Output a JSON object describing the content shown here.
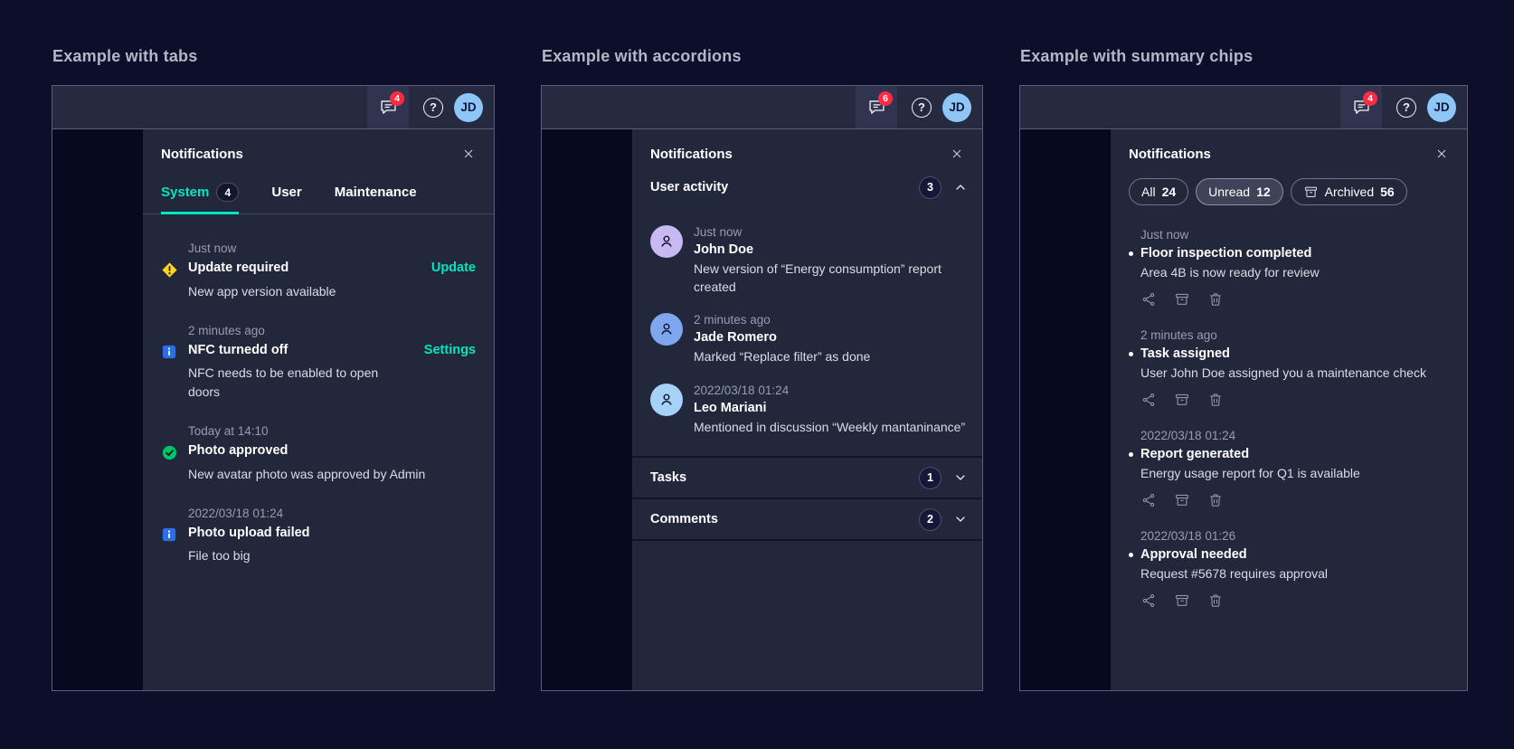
{
  "colors": {
    "accent_teal": "#00e7c1",
    "alert_red": "#ff2b43",
    "warning_yellow": "#ffd41f",
    "info_blue": "#2a6fe8",
    "success_green": "#00c466",
    "header_avatar_blue": "#8ec6f7"
  },
  "examples": {
    "tabs": {
      "heading": "Example with tabs",
      "appbar": {
        "notification_count": "4",
        "avatar_initials": "JD",
        "help_glyph": "?"
      },
      "panel": {
        "title": "Notifications",
        "tabs": [
          {
            "label": "System",
            "badge": "4",
            "active": true
          },
          {
            "label": "User",
            "active": false
          },
          {
            "label": "Maintenance",
            "active": false
          }
        ],
        "items": [
          {
            "icon": "warning",
            "time": "Just now",
            "title": "Update required",
            "description": "New app version available",
            "action": "Update"
          },
          {
            "icon": "info",
            "time": "2 minutes ago",
            "title": "NFC turnedd off",
            "description": "NFC needs to be enabled to open doors",
            "action": "Settings"
          },
          {
            "icon": "success",
            "time": "Today at 14:10",
            "title": "Photo approved",
            "description": "New avatar photo was approved by Admin"
          },
          {
            "icon": "info",
            "time": "2022/03/18 01:24",
            "title": "Photo upload failed",
            "description": "File too big"
          }
        ]
      }
    },
    "accordions": {
      "heading": "Example with accordions",
      "appbar": {
        "notification_count": "6",
        "avatar_initials": "JD",
        "help_glyph": "?"
      },
      "panel": {
        "title": "Notifications",
        "sections": [
          {
            "label": "User activity",
            "badge": "3",
            "expanded": true
          },
          {
            "label": "Tasks",
            "badge": "1",
            "expanded": false
          },
          {
            "label": "Comments",
            "badge": "2",
            "expanded": false
          }
        ],
        "user_activity_items": [
          {
            "time": "Just now",
            "name": "John Doe",
            "description": "New version of “Energy consumption” report created",
            "avatar_color": "#c9b9f2"
          },
          {
            "time": "2 minutes ago",
            "name": "Jade Romero",
            "description": "Marked “Replace filter” as done",
            "avatar_color": "#7fa7ee"
          },
          {
            "time": "2022/03/18 01:24",
            "name": "Leo Mariani",
            "description": "Mentioned in discussion “Weekly mantaninance”",
            "avatar_color": "#a5d2f6"
          }
        ]
      }
    },
    "chips": {
      "heading": "Example with summary chips",
      "appbar": {
        "notification_count": "4",
        "avatar_initials": "JD",
        "help_glyph": "?"
      },
      "panel": {
        "title": "Notifications",
        "chips": [
          {
            "label": "All",
            "count": "24",
            "selected": false
          },
          {
            "label": "Unread",
            "count": "12",
            "selected": true
          },
          {
            "label": "Archived",
            "count": "56",
            "selected": false,
            "icon": "archive"
          }
        ],
        "items": [
          {
            "time": "Just now",
            "title": "Floor inspection completed",
            "description": "Area 4B is now ready for review"
          },
          {
            "time": "2 minutes ago",
            "title": "Task assigned",
            "description": "User John Doe assigned you a maintenance check"
          },
          {
            "time": "2022/03/18 01:24",
            "title": "Report generated",
            "description": "Energy usage report for Q1 is available"
          },
          {
            "time": "2022/03/18 01:26",
            "title": "Approval needed",
            "description": "Request #5678 requires approval"
          }
        ]
      }
    }
  }
}
